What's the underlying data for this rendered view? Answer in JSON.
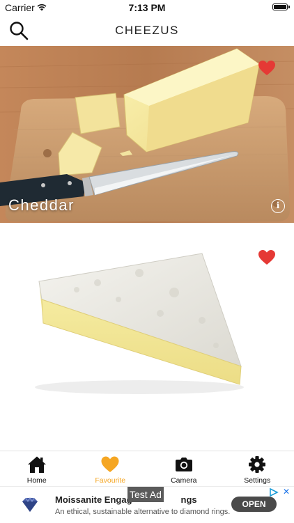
{
  "status_bar": {
    "carrier": "Carrier",
    "time": "7:13 PM"
  },
  "nav": {
    "title": "CHEEZUS"
  },
  "cards": [
    {
      "title": "Cheddar",
      "favourited": true,
      "image": "cheddar-on-board-with-knife"
    },
    {
      "title": "",
      "favourited": true,
      "image": "brie-wedge"
    }
  ],
  "tabs": [
    {
      "label": "Home",
      "icon": "home-icon"
    },
    {
      "label": "Favourite",
      "icon": "heart-icon",
      "active": true
    },
    {
      "label": "Camera",
      "icon": "camera-icon"
    },
    {
      "label": "Settings",
      "icon": "gear-icon"
    }
  ],
  "ad": {
    "test_label": "Test Ad",
    "headline": "Moissanite Engag",
    "headline_tail": "ngs",
    "body": "An ethical, sustainable alternative to diamond rings.",
    "cta": "OPEN"
  },
  "colors": {
    "favourite_active": "#f5a623",
    "heart": "#e53935"
  }
}
